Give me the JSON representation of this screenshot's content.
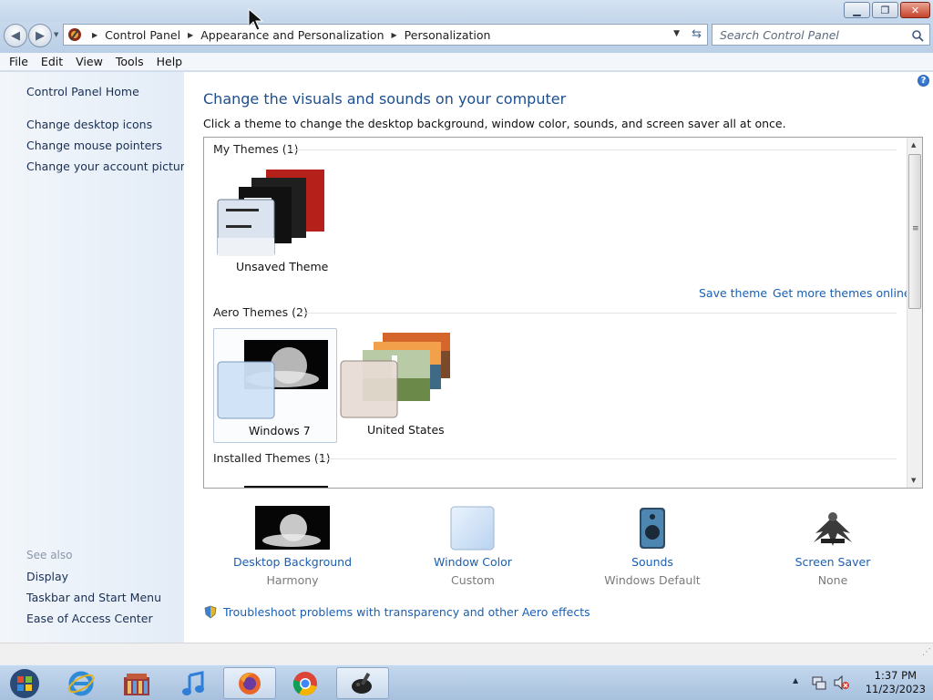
{
  "window": {
    "minimize_glyph": "▁",
    "maximize_glyph": "❐",
    "close_glyph": "✕"
  },
  "address": {
    "breadcrumbs": [
      "Control Panel",
      "Appearance and Personalization",
      "Personalization"
    ],
    "search_placeholder": "Search Control Panel"
  },
  "menu": [
    "File",
    "Edit",
    "View",
    "Tools",
    "Help"
  ],
  "sidebar": {
    "home": "Control Panel Home",
    "links": [
      "Change desktop icons",
      "Change mouse pointers",
      "Change your account picture"
    ],
    "see_also_label": "See also",
    "see_also": [
      "Display",
      "Taskbar and Start Menu",
      "Ease of Access Center"
    ]
  },
  "main": {
    "title": "Change the visuals and sounds on your computer",
    "subtitle": "Click a theme to change the desktop background, window color, sounds, and screen saver all at once.",
    "my_themes_header": "My Themes (1)",
    "unsaved_theme_label": "Unsaved Theme",
    "save_theme": "Save theme",
    "get_more_themes": "Get more themes online",
    "aero_themes_header": "Aero Themes (2)",
    "aero_themes": [
      "Windows 7",
      "United States"
    ],
    "installed_themes_header": "Installed Themes (1)",
    "selected_theme": "Windows 7"
  },
  "bottom": [
    {
      "label": "Desktop Background",
      "value": "Harmony",
      "icon": "desktop-background-icon"
    },
    {
      "label": "Window Color",
      "value": "Custom",
      "icon": "window-color-icon"
    },
    {
      "label": "Sounds",
      "value": "Windows Default",
      "icon": "speaker-icon"
    },
    {
      "label": "Screen Saver",
      "value": "None",
      "icon": "screen-saver-icon"
    }
  ],
  "troubleshoot": "Troubleshoot problems with transparency and other Aero effects",
  "taskbar": {
    "apps": [
      "start-orb-icon",
      "internet-explorer-icon",
      "library-icon",
      "itunes-icon",
      "firefox-icon",
      "chrome-icon",
      "paint-icon"
    ],
    "time": "1:37 PM",
    "date": "11/23/2023"
  },
  "colors": {
    "link": "#1a5fb4",
    "heading": "#1e4e8c",
    "taskbar": "#b6cce5"
  }
}
